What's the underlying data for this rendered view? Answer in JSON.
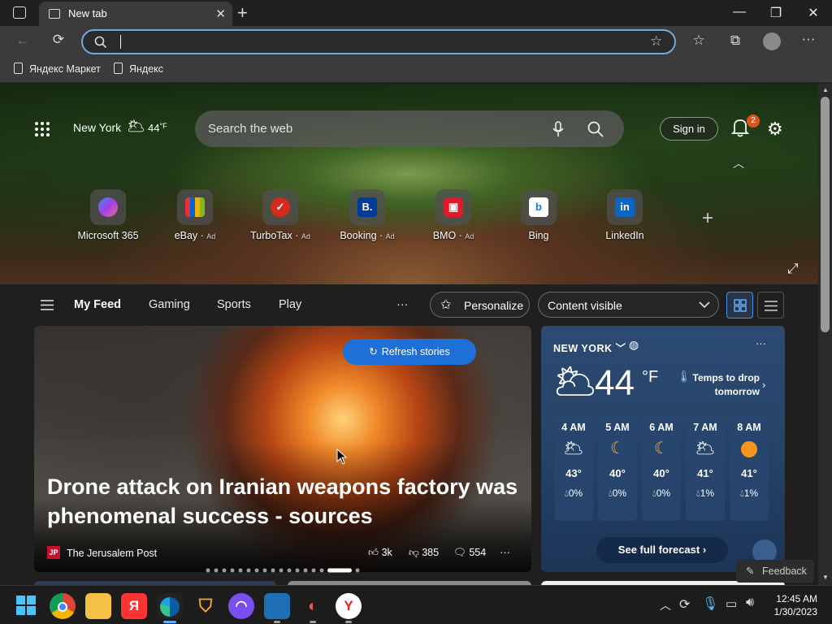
{
  "browser": {
    "tab_title": "New tab",
    "close_glyph": "✕",
    "new_tab_glyph": "+",
    "window_min": "—",
    "window_restore": "❐",
    "window_close": "✕",
    "address_value": ""
  },
  "bookmarks": [
    {
      "label": "Яндекс Маркет"
    },
    {
      "label": "Яндекс"
    }
  ],
  "header": {
    "location": "New York",
    "temp": "44",
    "temp_unit": "°F",
    "search_placeholder": "Search the web",
    "sign_in": "Sign in",
    "notification_count": "2"
  },
  "quick_links": [
    {
      "label": "Microsoft 365",
      "ad": "",
      "icon": "microsoft-365-icon",
      "color": "#7b3fe4"
    },
    {
      "label": "eBay",
      "ad": "Ad",
      "icon": "ebay-icon",
      "color": "#2f6b3a"
    },
    {
      "label": "TurboTax",
      "ad": "Ad",
      "icon": "turbotax-icon",
      "color": "#d52b1e"
    },
    {
      "label": "Booking",
      "ad": "Ad",
      "icon": "booking-icon",
      "color": "#003b95"
    },
    {
      "label": "BMO",
      "ad": "Ad",
      "icon": "bmo-icon",
      "color": "#e01a2b"
    },
    {
      "label": "Bing",
      "ad": "",
      "icon": "bing-icon",
      "color": "#ffffff"
    },
    {
      "label": "LinkedIn",
      "ad": "",
      "icon": "linkedin-icon",
      "color": "#0a66c2"
    }
  ],
  "feed_nav": {
    "items": [
      "My Feed",
      "Gaming",
      "Sports",
      "Play"
    ],
    "more": "···",
    "personalize": "Personalize",
    "content_visible": "Content visible"
  },
  "news": {
    "refresh": "Refresh stories",
    "headline": "Drone attack on Iranian weapons factory was phenomenal success - sources",
    "source": "The Jerusalem Post",
    "source_logo": "JP",
    "likes": "3k",
    "dislikes": "385",
    "comments": "554",
    "more": "···"
  },
  "weather": {
    "city": "NEW YORK",
    "temp": "44",
    "unit": "°F",
    "alert": "Temps to drop tomorrow",
    "more": "···",
    "hours": [
      {
        "time": "4 AM",
        "temp": "43°",
        "precip": "0%",
        "icon": "partly-cloudy-night-icon"
      },
      {
        "time": "5 AM",
        "temp": "40°",
        "precip": "0%",
        "icon": "moon-icon"
      },
      {
        "time": "6 AM",
        "temp": "40°",
        "precip": "0%",
        "icon": "moon-icon"
      },
      {
        "time": "7 AM",
        "temp": "41°",
        "precip": "1%",
        "icon": "partly-cloudy-night-icon"
      },
      {
        "time": "8 AM",
        "temp": "41°",
        "precip": "1%",
        "icon": "sun-icon"
      }
    ],
    "full_forecast": "See full forecast"
  },
  "feedback": "Feedback",
  "taskbar": {
    "time": "12:45 AM",
    "date": "1/30/2023"
  }
}
